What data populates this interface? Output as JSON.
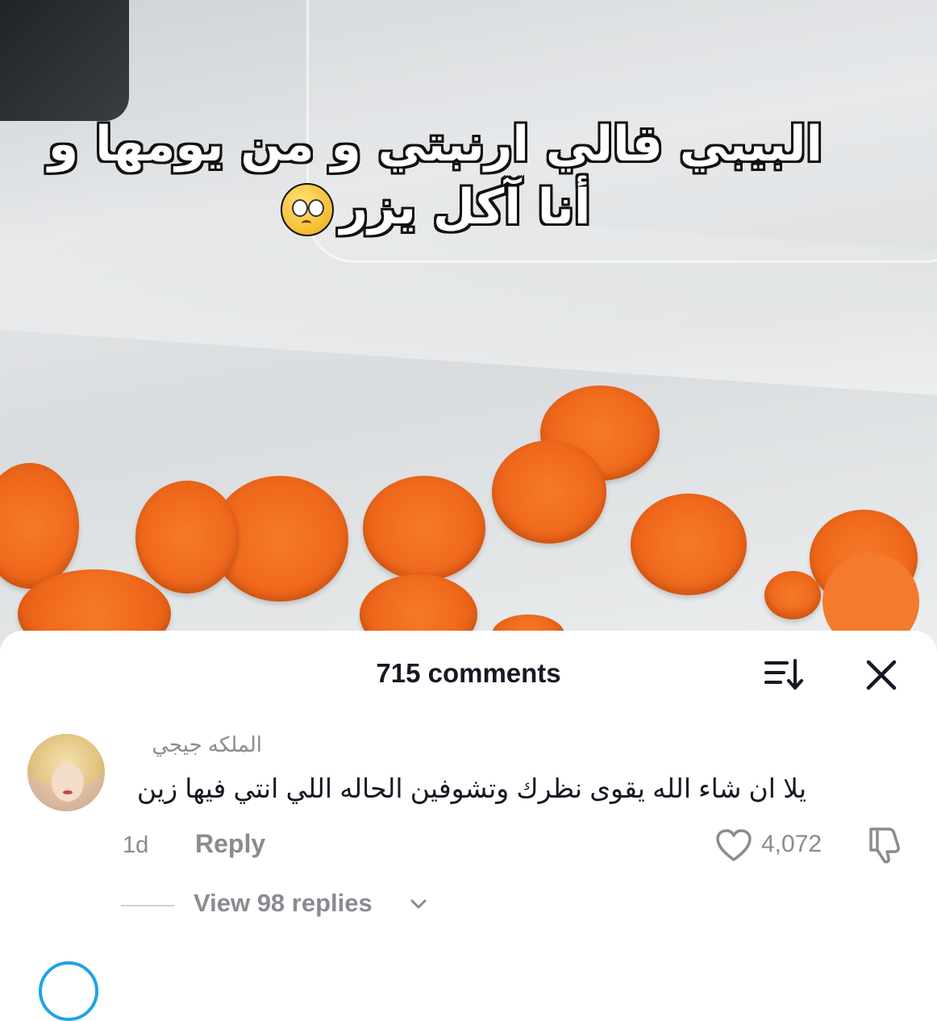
{
  "video": {
    "caption_line1": "البيبي قالي ارنبتي و من يومها و",
    "caption_line2": "أنا آكل يزر",
    "emoji_icon": "pleading-face-emoji"
  },
  "comments_panel": {
    "count_label": "715 comments",
    "sort_icon": "sort-icon",
    "close_icon": "close-icon"
  },
  "comment": {
    "username": "الملكه جيجي",
    "text": "يلا ان شاء الله يقوى نظرك وتشوفين الحاله اللي انتي فيها زين",
    "time": "1d",
    "reply_label": "Reply",
    "like_count": "4,072",
    "like_icon": "heart-icon",
    "dislike_icon": "thumbs-down-icon",
    "view_replies_label": "View 98 replies",
    "view_replies_icon": "chevron-down-icon"
  },
  "colors": {
    "primary_text": "#161823",
    "secondary_text": "#8a8b91",
    "accent_orange": "#f47a2e"
  }
}
